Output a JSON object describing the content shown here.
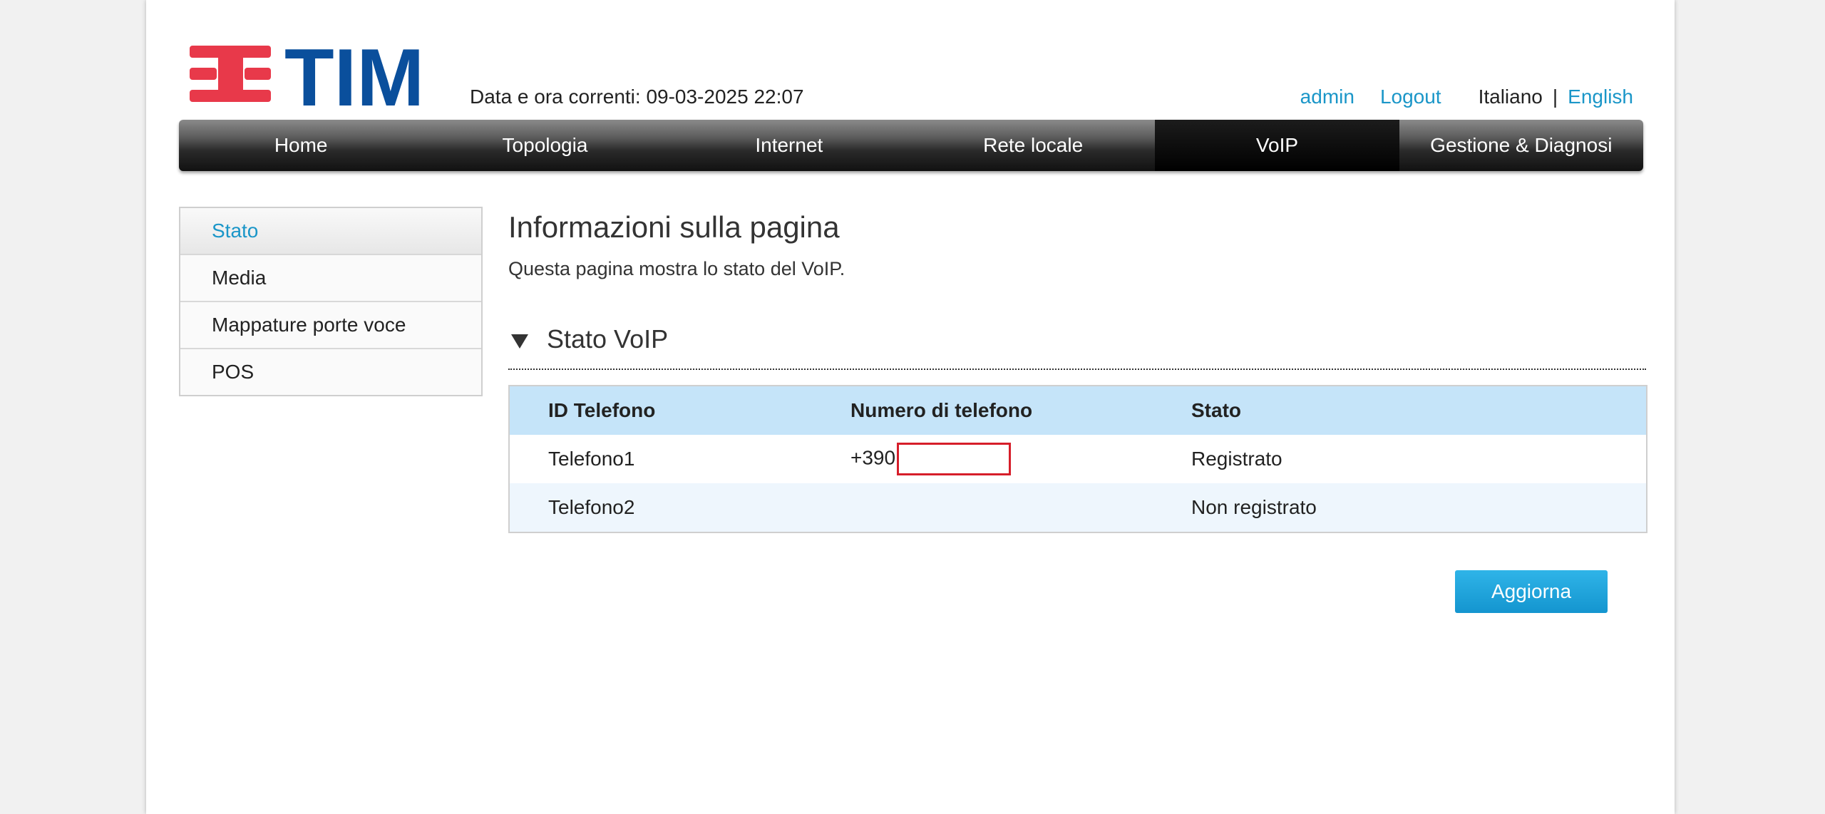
{
  "header": {
    "logo_text": "TIM",
    "datetime": "Data e ora correnti: 09-03-2025 22:07",
    "user": "admin",
    "logout": "Logout",
    "lang_current": "Italiano",
    "lang_sep": "|",
    "lang_other": "English"
  },
  "nav": {
    "items": [
      "Home",
      "Topologia",
      "Internet",
      "Rete locale",
      "VoIP",
      "Gestione & Diagnosi"
    ],
    "active": "VoIP"
  },
  "sidebar": {
    "items": [
      "Stato",
      "Media",
      "Mappature porte voce",
      "POS"
    ],
    "active": "Stato"
  },
  "main": {
    "title": "Informazioni sulla pagina",
    "description": "Questa pagina mostra lo stato del VoIP.",
    "section_title": "Stato VoIP",
    "table": {
      "headers": [
        "ID Telefono",
        "Numero di telefono",
        "Stato"
      ],
      "rows": [
        [
          "Telefono1",
          "+390",
          "Registrato"
        ],
        [
          "Telefono2",
          "",
          "Non registrato"
        ]
      ]
    },
    "refresh_button": "Aggiorna"
  },
  "colors": {
    "accent": "#1a96c8",
    "logo_red": "#e8394a",
    "logo_blue": "#0a4f9c",
    "table_header": "#c5e4f9",
    "redaction": "#d61e2a"
  },
  "icons": {
    "logo": "tim-logo",
    "section_toggle": "triangle-down-icon"
  }
}
